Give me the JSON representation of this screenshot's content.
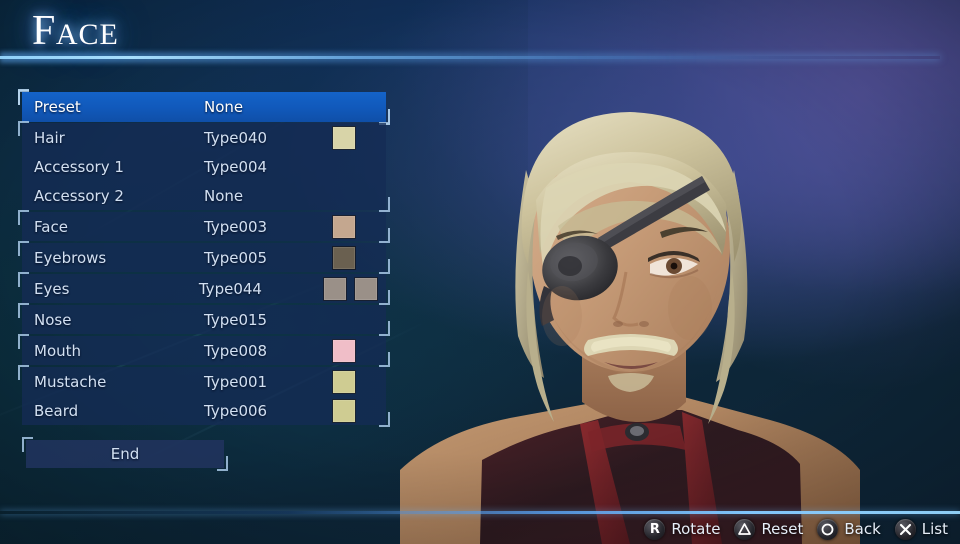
{
  "screen": {
    "title": {
      "first_letter": "F",
      "rest": "ACE",
      "full": "FACE"
    }
  },
  "menu": {
    "groups": [
      {
        "selected": true,
        "rows": [
          {
            "label": "Preset",
            "value": "None",
            "swatches": [],
            "selected": true
          }
        ]
      },
      {
        "selected": false,
        "rows": [
          {
            "label": "Hair",
            "value": "Type040",
            "swatches": [
              "#d8d4a8"
            ],
            "selected": false
          },
          {
            "label": "Accessory 1",
            "value": "Type004",
            "swatches": [],
            "selected": false
          },
          {
            "label": "Accessory 2",
            "value": "None",
            "swatches": [],
            "selected": false
          }
        ]
      },
      {
        "selected": false,
        "rows": [
          {
            "label": "Face",
            "value": "Type003",
            "swatches": [
              "#c4a78f"
            ],
            "selected": false
          }
        ]
      },
      {
        "selected": false,
        "rows": [
          {
            "label": "Eyebrows",
            "value": "Type005",
            "swatches": [
              "#6a6050"
            ],
            "selected": false
          }
        ]
      },
      {
        "selected": false,
        "rows": [
          {
            "label": "Eyes",
            "value": "Type044",
            "swatches": [
              "#9a9088",
              "#9a9088"
            ],
            "selected": false
          }
        ]
      },
      {
        "selected": false,
        "rows": [
          {
            "label": "Nose",
            "value": "Type015",
            "swatches": [],
            "selected": false
          }
        ]
      },
      {
        "selected": false,
        "rows": [
          {
            "label": "Mouth",
            "value": "Type008",
            "swatches": [
              "#f0bec8"
            ],
            "selected": false
          }
        ]
      },
      {
        "selected": false,
        "rows": [
          {
            "label": "Mustache",
            "value": "Type001",
            "swatches": [
              "#cfcc92"
            ],
            "selected": false
          },
          {
            "label": "Beard",
            "value": "Type006",
            "swatches": [
              "#cfcc92"
            ],
            "selected": false
          }
        ]
      }
    ],
    "end_button": {
      "label": "End"
    }
  },
  "footer": {
    "hints": [
      {
        "icon": "ps-r-button-icon",
        "glyph": "R",
        "label": "Rotate"
      },
      {
        "icon": "ps-triangle-button-icon",
        "glyph": "triangle",
        "label": "Reset"
      },
      {
        "icon": "ps-circle-button-icon",
        "glyph": "circle",
        "label": "Back"
      },
      {
        "icon": "ps-cross-button-icon",
        "glyph": "cross",
        "label": "List"
      }
    ]
  },
  "character": {
    "description": "male character portrait with blond hair, eyepatch over left eye and mustache"
  },
  "colors": {
    "selection_blue": "#1463c8",
    "panel_navy": "#142c54",
    "text_light": "#d2e0f2",
    "accent_line": "#7ec0ff"
  }
}
